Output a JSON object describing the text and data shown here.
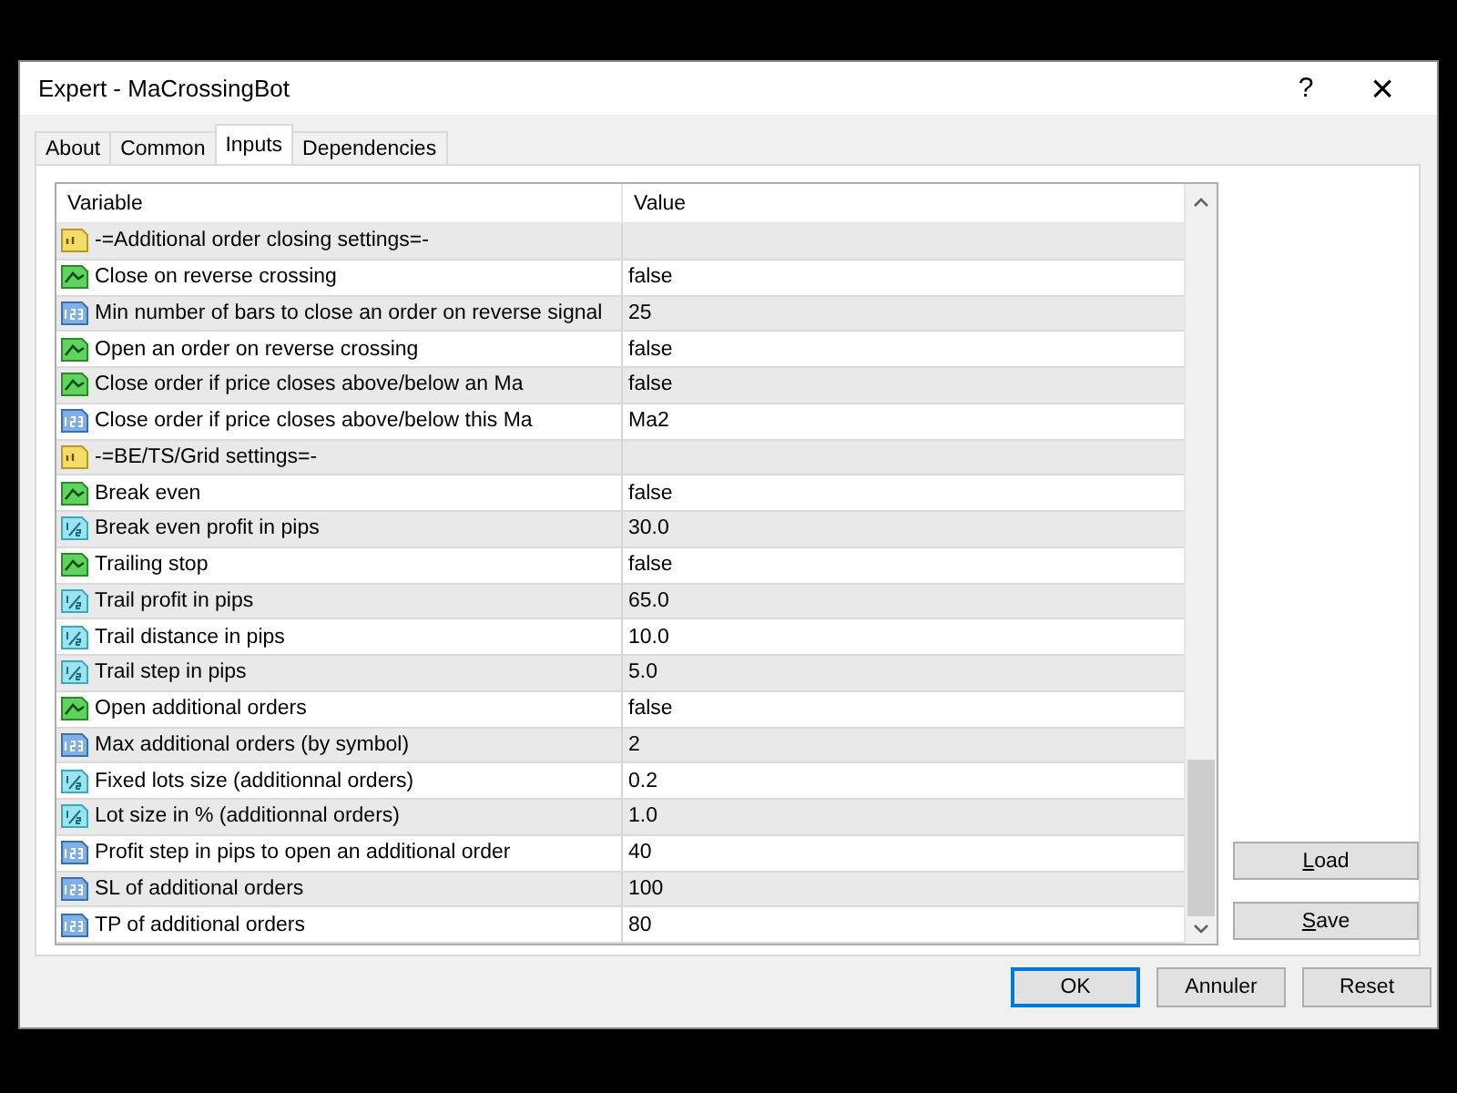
{
  "window": {
    "title": "Expert - MaCrossingBot",
    "help": "?",
    "close": "×"
  },
  "tabs": [
    {
      "label": "About",
      "selected": false
    },
    {
      "label": "Common",
      "selected": false
    },
    {
      "label": "Inputs",
      "selected": true
    },
    {
      "label": "Dependencies",
      "selected": false
    }
  ],
  "table": {
    "columns": [
      "Variable",
      "Value"
    ],
    "rows": [
      {
        "kind": "string",
        "variable": "-=Additional order closing settings=-",
        "value": ""
      },
      {
        "kind": "bool",
        "variable": "Close on reverse crossing",
        "value": "false"
      },
      {
        "kind": "int",
        "variable": "Min number of bars to close an order on reverse signal",
        "value": "25"
      },
      {
        "kind": "bool",
        "variable": "Open an order on reverse crossing",
        "value": "false"
      },
      {
        "kind": "bool",
        "variable": "Close order if price closes above/below an Ma",
        "value": "false"
      },
      {
        "kind": "int",
        "variable": "Close order if price closes above/below this Ma",
        "value": "Ma2"
      },
      {
        "kind": "string",
        "variable": "-=BE/TS/Grid settings=-",
        "value": ""
      },
      {
        "kind": "bool",
        "variable": "Break even",
        "value": "false"
      },
      {
        "kind": "double",
        "variable": "Break even profit in pips",
        "value": "30.0"
      },
      {
        "kind": "bool",
        "variable": "Trailing stop",
        "value": "false"
      },
      {
        "kind": "double",
        "variable": "Trail profit in pips",
        "value": "65.0"
      },
      {
        "kind": "double",
        "variable": "Trail distance in pips",
        "value": "10.0"
      },
      {
        "kind": "double",
        "variable": "Trail step in pips",
        "value": "5.0"
      },
      {
        "kind": "bool",
        "variable": "Open additional orders",
        "value": "false"
      },
      {
        "kind": "int",
        "variable": "Max additional orders (by symbol)",
        "value": "2"
      },
      {
        "kind": "double",
        "variable": "Fixed lots size (additionnal orders)",
        "value": "0.2"
      },
      {
        "kind": "double",
        "variable": "Lot size in % (additionnal orders)",
        "value": "1.0"
      },
      {
        "kind": "int",
        "variable": "Profit step in pips to open an additional order",
        "value": "40"
      },
      {
        "kind": "int",
        "variable": "SL of additional orders",
        "value": "100"
      },
      {
        "kind": "int",
        "variable": "TP of additional orders",
        "value": "80"
      }
    ]
  },
  "side_buttons": [
    {
      "label": "Load",
      "mnemonic": true
    },
    {
      "label": "Save",
      "mnemonic": true
    }
  ],
  "buttons": [
    {
      "label": "OK",
      "default": true
    },
    {
      "label": "Annuler",
      "default": false
    },
    {
      "label": "Reset",
      "default": false
    }
  ]
}
